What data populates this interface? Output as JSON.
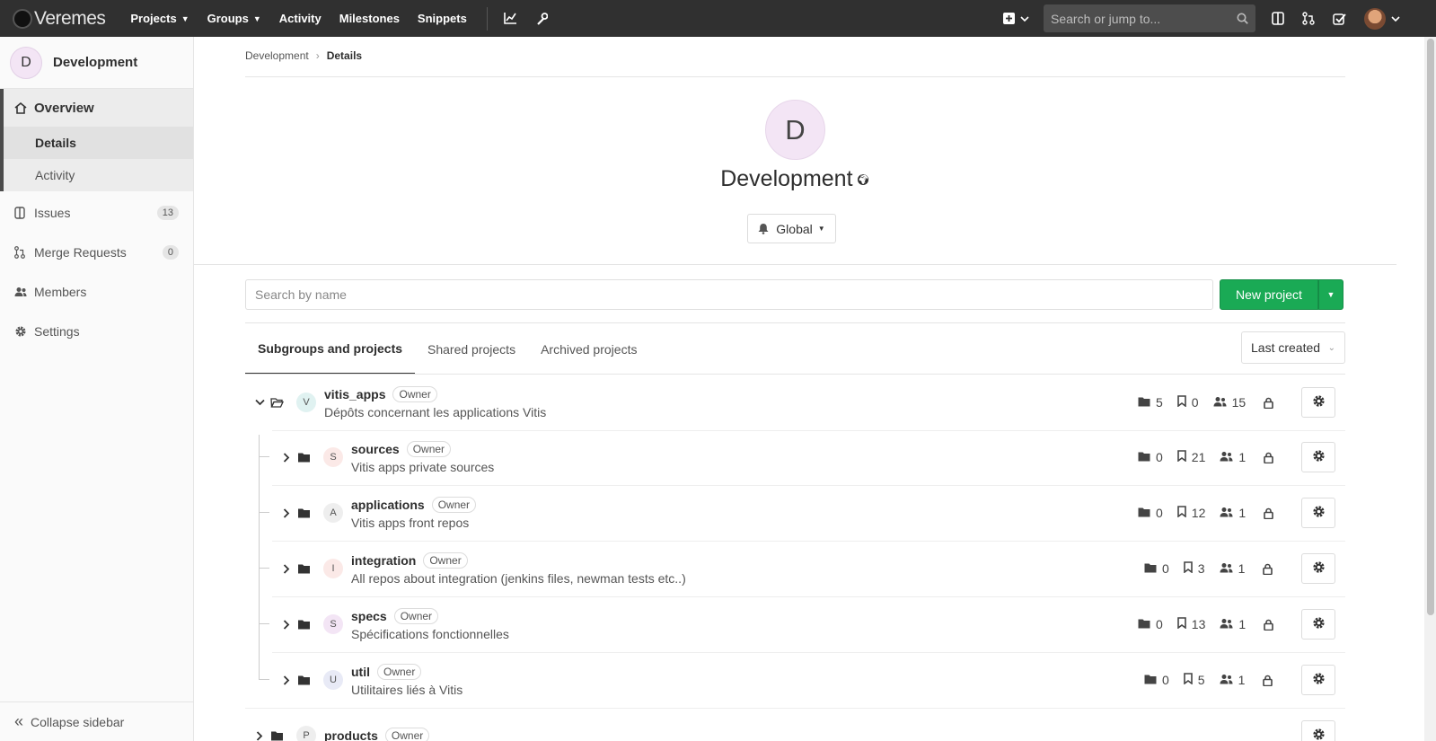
{
  "navbar": {
    "brand": "Veremes",
    "links": [
      {
        "label": "Projects",
        "dropdown": true
      },
      {
        "label": "Groups",
        "dropdown": true
      },
      {
        "label": "Activity",
        "dropdown": false
      },
      {
        "label": "Milestones",
        "dropdown": false
      },
      {
        "label": "Snippets",
        "dropdown": false
      }
    ],
    "search_placeholder": "Search or jump to..."
  },
  "sidebar": {
    "context_initial": "D",
    "context_title": "Development",
    "overview_label": "Overview",
    "sub_items": [
      "Details",
      "Activity"
    ],
    "items": [
      {
        "label": "Issues",
        "count": "13",
        "icon": "issues-icon"
      },
      {
        "label": "Merge Requests",
        "count": "0",
        "icon": "merge-request-icon"
      },
      {
        "label": "Members",
        "count": null,
        "icon": "members-icon"
      },
      {
        "label": "Settings",
        "count": null,
        "icon": "settings-icon"
      }
    ],
    "collapse_label": "Collapse sidebar"
  },
  "breadcrumb": {
    "parent": "Development",
    "separator": "›",
    "current": "Details"
  },
  "group": {
    "initial": "D",
    "title": "Development",
    "notification_label": "Global"
  },
  "filter": {
    "placeholder": "Search by name",
    "new_project_label": "New project"
  },
  "tabs": [
    "Subgroups and projects",
    "Shared projects",
    "Archived projects"
  ],
  "sort_label": "Last created",
  "rows": [
    {
      "initial": "V",
      "name": "vitis_apps",
      "role": "Owner",
      "description": "Dépôts concernant les applications Vitis",
      "subgroups": "5",
      "projects": "0",
      "members": "15",
      "avatar_color": "#e0f2f1",
      "expanded": true
    },
    {
      "initial": "S",
      "name": "sources",
      "role": "Owner",
      "description": "Vitis apps private sources",
      "subgroups": "0",
      "projects": "21",
      "members": "1",
      "avatar_color": "#fbe9e7"
    },
    {
      "initial": "A",
      "name": "applications",
      "role": "Owner",
      "description": "Vitis apps front repos",
      "subgroups": "0",
      "projects": "12",
      "members": "1",
      "avatar_color": "#eeeeee"
    },
    {
      "initial": "I",
      "name": "integration",
      "role": "Owner",
      "description": "All repos about integration (jenkins files, newman tests etc..)",
      "subgroups": "0",
      "projects": "3",
      "members": "1",
      "avatar_color": "#fbe9e7"
    },
    {
      "initial": "S",
      "name": "specs",
      "role": "Owner",
      "description": "Spécifications fonctionnelles",
      "subgroups": "0",
      "projects": "13",
      "members": "1",
      "avatar_color": "#f3e5f5"
    },
    {
      "initial": "U",
      "name": "util",
      "role": "Owner",
      "description": "Utilitaires liés à Vitis",
      "subgroups": "0",
      "projects": "5",
      "members": "1",
      "avatar_color": "#e8eaf6"
    },
    {
      "initial": "P",
      "name": "products",
      "role": "Owner",
      "description": "",
      "subgroups": "",
      "projects": "",
      "members": "",
      "avatar_color": "#eeeeee"
    }
  ],
  "colors": {
    "navbar_bg": "#303030",
    "success_green": "#1aaa55",
    "sidebar_bg": "#fafafa"
  }
}
